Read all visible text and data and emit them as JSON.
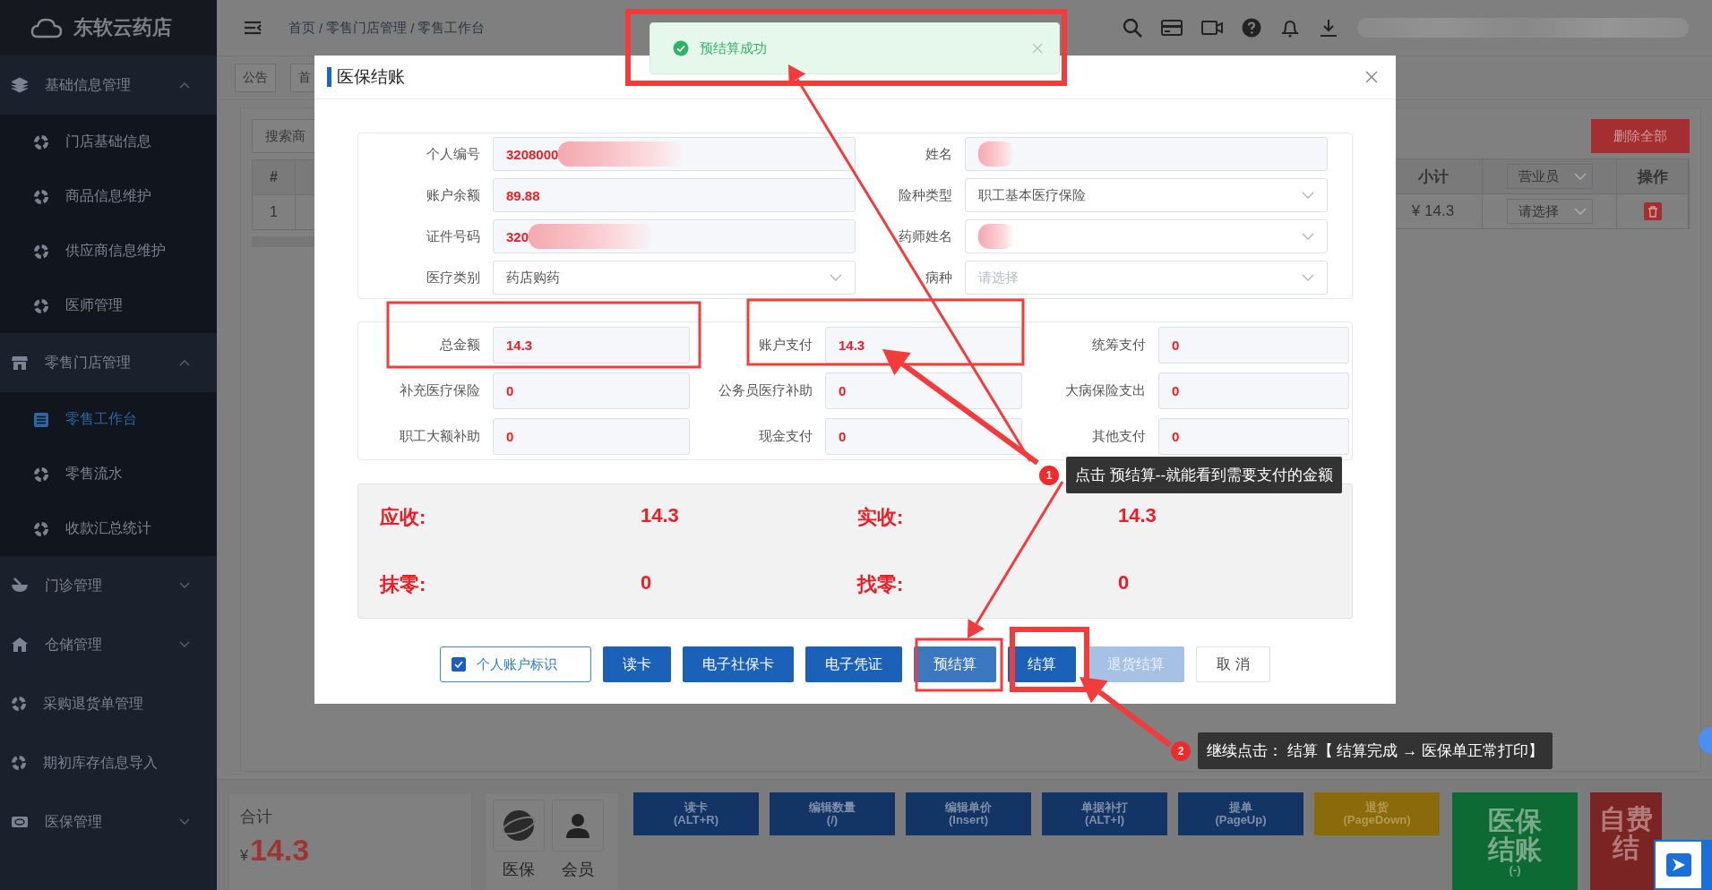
{
  "logo": {
    "text": "东软云药店"
  },
  "sidebar": {
    "items": [
      {
        "kind": "group",
        "label": "基础信息管理",
        "expanded": true,
        "children": [
          {
            "label": "门店基础信息",
            "selected": false
          },
          {
            "label": "商品信息维护",
            "selected": false
          },
          {
            "label": "供应商信息维护",
            "selected": false
          },
          {
            "label": "医师管理",
            "selected": false
          }
        ]
      },
      {
        "kind": "group",
        "label": "零售门店管理",
        "expanded": true,
        "children": [
          {
            "label": "零售工作台",
            "selected": true
          },
          {
            "label": "零售流水",
            "selected": false
          },
          {
            "label": "收款汇总统计",
            "selected": false
          }
        ]
      },
      {
        "kind": "group",
        "label": "门诊管理",
        "expanded": false
      },
      {
        "kind": "group",
        "label": "仓储管理",
        "expanded": false
      },
      {
        "kind": "link",
        "label": "采购退货单管理"
      },
      {
        "kind": "link",
        "label": "期初库存信息导入"
      },
      {
        "kind": "group",
        "label": "医保管理",
        "expanded": false
      }
    ]
  },
  "topbar": {
    "breadcrumb": [
      "首页",
      "零售门店管理",
      "零售工作台"
    ],
    "separator": "/"
  },
  "page_tabs": [
    {
      "label": "公告"
    },
    {
      "label": "首"
    }
  ],
  "workbench": {
    "search": {
      "placeholder": "搜索商"
    },
    "left_columns": [
      "#"
    ],
    "left_rows": [
      [
        "1"
      ]
    ],
    "delete_all": "删除全部",
    "right_columns": [
      {
        "kind": "text",
        "label": "小计"
      },
      {
        "kind": "select",
        "label": "营业员"
      },
      {
        "kind": "text",
        "label": "操作"
      }
    ],
    "right_rows": [
      {
        "subtotal": "¥ 14.3",
        "salesperson_placeholder": "请选择"
      }
    ]
  },
  "bottom": {
    "total_label": "合计",
    "currency": "¥",
    "total": "14.3",
    "quick": [
      {
        "label": "医保"
      },
      {
        "label": "会员"
      }
    ],
    "shortcuts": [
      {
        "label": "读卡",
        "key": "(ALT+R)",
        "color": "#133566"
      },
      {
        "label": "编辑数量",
        "key": "(/)",
        "color": "#133566"
      },
      {
        "label": "编辑单价",
        "key": "(Insert)",
        "color": "#133566"
      },
      {
        "label": "单据补打",
        "key": "(ALT+I)",
        "color": "#133566"
      },
      {
        "label": "提单",
        "key": "(PageUp)",
        "color": "#133566"
      },
      {
        "label": "退货",
        "key": "(PageDown)",
        "color": "#8a6a0a"
      }
    ],
    "checkouts": [
      {
        "label": "医保结账",
        "key": "(-)",
        "color": "#0d6a33"
      },
      {
        "label": "自费结",
        "color": "#7a2424"
      }
    ]
  },
  "modal": {
    "title": "医保结账",
    "info": [
      {
        "kind": "text",
        "label": "个人编号",
        "value": "3208000",
        "redacted": true
      },
      {
        "kind": "text",
        "label": "姓名",
        "redacted": true
      },
      {
        "kind": "text",
        "label": "账户余额",
        "value": "89.88",
        "redacted": false
      },
      {
        "kind": "select",
        "label": "险种类型",
        "value": "职工基本医疗保险",
        "redacted": false
      },
      {
        "kind": "text",
        "label": "证件号码",
        "value": "320",
        "redacted": true
      },
      {
        "kind": "select",
        "label": "药师姓名",
        "redacted": true
      },
      {
        "kind": "select",
        "label": "医疗类别",
        "value": "药店购药",
        "redacted": false
      },
      {
        "kind": "select",
        "label": "病种",
        "placeholder": "请选择",
        "redacted": false
      }
    ],
    "payments": [
      {
        "label": "总金额",
        "value": "14.3"
      },
      {
        "label": "账户支付",
        "value": "14.3"
      },
      {
        "label": "统筹支付",
        "value": "0"
      },
      {
        "label": "补充医疗保险",
        "value": "0"
      },
      {
        "label": "公务员医疗补助",
        "value": "0"
      },
      {
        "label": "大病保险支出",
        "value": "0"
      },
      {
        "label": "职工大额补助",
        "value": "0"
      },
      {
        "label": "现金支付",
        "value": "0"
      },
      {
        "label": "其他支付",
        "value": "0"
      }
    ],
    "summary": [
      {
        "label": "应收:",
        "value": "14.3"
      },
      {
        "label": "实收:",
        "value": "14.3"
      },
      {
        "label": "抹零:",
        "value": "0"
      },
      {
        "label": "找零:",
        "value": "0"
      }
    ],
    "account_flag": {
      "label": "个人账户标识",
      "checked": true
    },
    "buttons": [
      {
        "label": "读卡",
        "kind": "primary"
      },
      {
        "label": "电子社保卡",
        "kind": "primary"
      },
      {
        "label": "电子凭证",
        "kind": "primary"
      },
      {
        "label": "预结算",
        "kind": "hover"
      },
      {
        "label": "结算",
        "kind": "primary"
      },
      {
        "label": "退货结算",
        "kind": "disabled"
      },
      {
        "label": "取 消",
        "kind": "default"
      }
    ]
  },
  "toast": {
    "kind": "success",
    "text": "预结算成功"
  },
  "callouts": [
    {
      "number": "1",
      "text": "点击 预结算--就能看到需要支付的金额"
    },
    {
      "number": "2",
      "text": "继续点击： 结算【 结算完成 → 医保单正常打印】"
    }
  ]
}
